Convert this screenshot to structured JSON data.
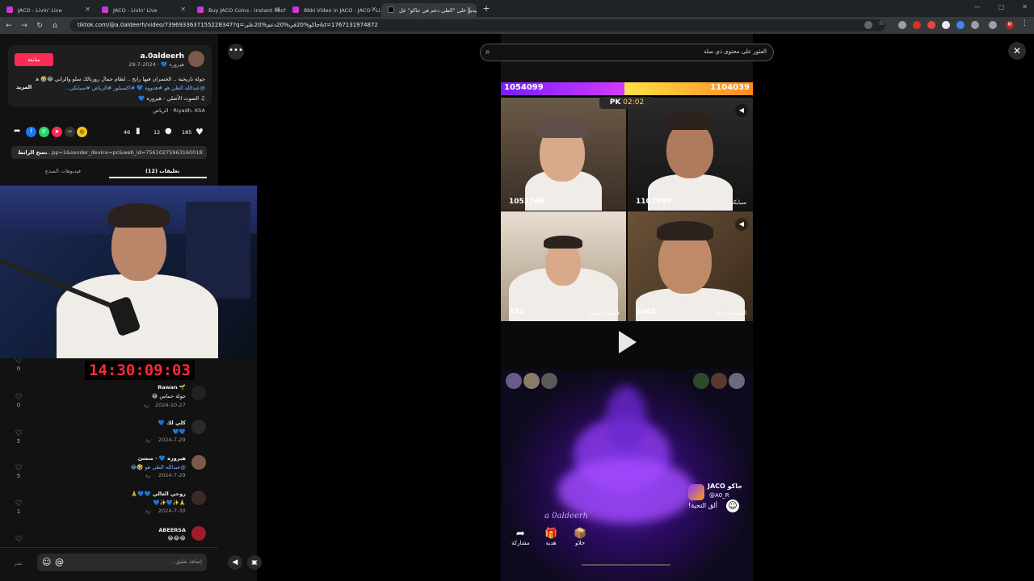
{
  "browser": {
    "tabs": [
      {
        "title": "JACO - Livin' Live",
        "active": false
      },
      {
        "title": "JACO - Livin' Live",
        "active": false
      },
      {
        "title": "Buy JACO Coins - Instant Rech...",
        "active": false
      },
      {
        "title": "8bbi Video in JACO - JACO - Li...",
        "active": false
      },
      {
        "title": "الفيديو على \"الطي دعم في جاكو\" عل...",
        "active": true
      }
    ],
    "url": "tiktok.com/@a.0aldeerh/video/7396933637155228347?q=جاكو%20في%20دعم%20على&t=1767131974872",
    "profile_initial": "M"
  },
  "search": {
    "placeholder": "العثور على محتوى ذي صلة"
  },
  "post": {
    "username": "a.0aldeerh",
    "display_line": "هيروره 💙 · 2024-7-29",
    "follow_label": "متابعة",
    "caption_line1": "جولة تاريخية .. الخسران فيها رابح .. لطام جمال روزنالك سلو والراني 😂🤣 هو",
    "caption_line2": "@عبدالله الطي هو #هدووه 💙 #اكسبلور #الرياض #سبايكي...",
    "more_label": "المزيد",
    "sound": "♫ الصوت الأصلي - هيروره 💙",
    "location": "Riyadh, KSA · الرياض",
    "likes": "185",
    "comments": "12",
    "saves": "46",
    "link_text": "...pp=1&sender_device=pc&web_id=7561027596316001812",
    "copy_link_label": "نسخ الرابط",
    "tab_comments": "تعليقات (12)",
    "tab_creator_videos": "فيديوهات المبدع"
  },
  "stream_overlay": {
    "timer": "14:30:09:03"
  },
  "comments": [
    {
      "user": "🌱 Rawan",
      "text": "جولة حماس 😂",
      "date": "2024-10-27",
      "reply": "رد",
      "likes": "0"
    },
    {
      "user": "كلي لك 💙",
      "text": "💙💙",
      "date": "2024-7-29",
      "reply": "رد",
      "likes": "5"
    },
    {
      "user": "هيروره 💙 · منشئ",
      "text": "@عبدالله الطي هو 🤣😂",
      "date": "2024-7-29",
      "reply": "رد",
      "likes": "5"
    },
    {
      "user": "روحي الغالي 💙💙🙏",
      "text": "🙏✨💙✨💙",
      "date": "2024-7-30",
      "reply": "رد",
      "likes": "1"
    },
    {
      "user": "ABEERSA",
      "text": "😂😂😂",
      "date": "",
      "reply": "",
      "likes": ""
    }
  ],
  "first_like_count": "0",
  "comment_input": {
    "placeholder": "إضافة تعليق...",
    "post_label": "نشر"
  },
  "live": {
    "score_left": "1054099",
    "score_right": "1104039",
    "pk_label": "PK",
    "pk_time": "02:02",
    "cells": [
      {
        "score": "1053766",
        "name": ""
      },
      {
        "score": "1102980",
        "name": "سبايكي"
      },
      {
        "score": "333",
        "name": "فيصل البقمي"
      },
      {
        "score": "1062",
        "name": "السلطان خالد..."
      }
    ],
    "brand": "JACO جاكو",
    "handle": "@A0_R",
    "watermark": "a 0aldeerh",
    "greet": "ألق التحية!",
    "actions": [
      {
        "label": "حلاو",
        "icon": "📦"
      },
      {
        "label": "هدية",
        "icon": "🎁"
      },
      {
        "label": "مشاركة",
        "icon": "➦"
      }
    ]
  }
}
